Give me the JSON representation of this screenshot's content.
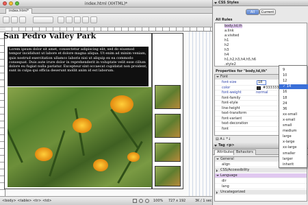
{
  "window": {
    "title": "index.html (XHTML)*",
    "tab": "index.html*"
  },
  "document": {
    "heading": "San Pedro Valley Park",
    "paragraph": "Lorem ipsum dolor sit amet, consectetur adipiscing elit, sed do eiusmod tempor incididunt ut labore et dolore magna aliqua. Ut enim ad minim veniam, quis nostrud exercitation ullamco laboris nisi ut aliquip ex ea commodo consequat. Duis aute irure dolor in reprehenderit in voluptate velit esse cillum dolore eu fugiat nulla pariatur. Excepteur sint occaecat cupidatat non proident, sunt in culpa qui officia deserunt mollit anim id est laborum.",
    "link_text": "aliquip"
  },
  "status": {
    "tag_path": "<body> <table> <tr> <td>",
    "zoom": "100%",
    "dims": "727 x 192",
    "size": "3K / 1 sec"
  },
  "css_panel": {
    "title": "CSS Styles",
    "mode_all": "All",
    "mode_current": "Current",
    "all_rules_label": "All Rules",
    "rules": [
      "body,td,th",
      "a:link",
      "a:visited",
      "h1",
      "h2",
      "h3",
      "h4",
      "h1,h2,h3,h4,h5,h6",
      ".style2"
    ],
    "properties_label": "Properties for \"body,td,th\"",
    "category": "Font",
    "properties": [
      {
        "name": "font-size",
        "value": "18",
        "set": true
      },
      {
        "name": "color",
        "value": "#333333",
        "set": true
      },
      {
        "name": "font-weight",
        "value": "normal",
        "set": true
      },
      {
        "name": "font-family",
        "value": ""
      },
      {
        "name": "font-style",
        "value": ""
      },
      {
        "name": "line-height",
        "value": ""
      },
      {
        "name": "text-transform",
        "value": ""
      },
      {
        "name": "font-variant",
        "value": ""
      },
      {
        "name": "text-decoration",
        "value": ""
      },
      {
        "name": "font",
        "value": ""
      }
    ],
    "font_size_options": [
      "9",
      "10",
      "12",
      "14",
      "16",
      "18",
      "24",
      "36",
      "xx-small",
      "x-small",
      "small",
      "medium",
      "large",
      "x-large",
      "xx-large",
      "smaller",
      "larger",
      "inherit"
    ],
    "font_size_selected": "14"
  },
  "tag_panel": {
    "title": "Tag <p>",
    "tabs": [
      "Attributes",
      "Behaviors"
    ],
    "sections": [
      {
        "label": "General",
        "highlight": false,
        "open": true,
        "rows": [
          "align"
        ]
      },
      {
        "label": "CSS/Accessibility",
        "highlight": false,
        "open": false,
        "rows": []
      },
      {
        "label": "Language",
        "highlight": true,
        "open": true,
        "rows": [
          "dir",
          "lang"
        ]
      },
      {
        "label": "Uncategorized",
        "highlight": false,
        "open": false,
        "rows": []
      }
    ]
  }
}
